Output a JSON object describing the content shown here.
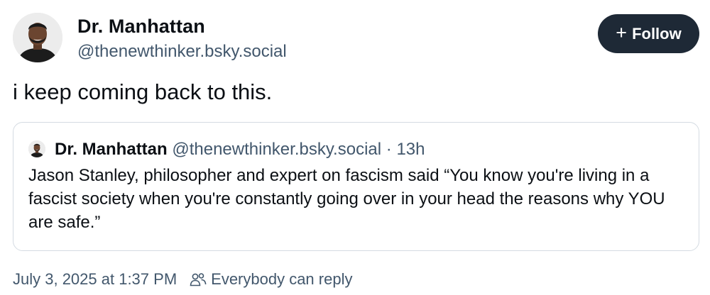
{
  "post": {
    "author": {
      "display_name": "Dr. Manhattan",
      "handle": "@thenewthinker.bsky.social",
      "avatar_icon": "profile-photo"
    },
    "follow_button": {
      "icon": "plus-icon",
      "label": "Follow"
    },
    "text": "i keep coming back to this.",
    "quote": {
      "author_name": "Dr. Manhattan",
      "handle": "@thenewthinker.bsky.social",
      "separator": "·",
      "time": "13h",
      "text": "Jason Stanley, philosopher and expert on fascism said “You know you're living in a fascist society when you're constantly going over in your head the reasons why YOU are safe.”"
    },
    "footer": {
      "timestamp": "July 3, 2025 at 1:37 PM",
      "reply_icon": "people-icon",
      "reply_setting": "Everybody can reply"
    }
  },
  "colors": {
    "text_primary": "#0b0f14",
    "text_secondary": "#42576c",
    "button_bg": "#1e2936",
    "border": "#d4dbe2"
  }
}
